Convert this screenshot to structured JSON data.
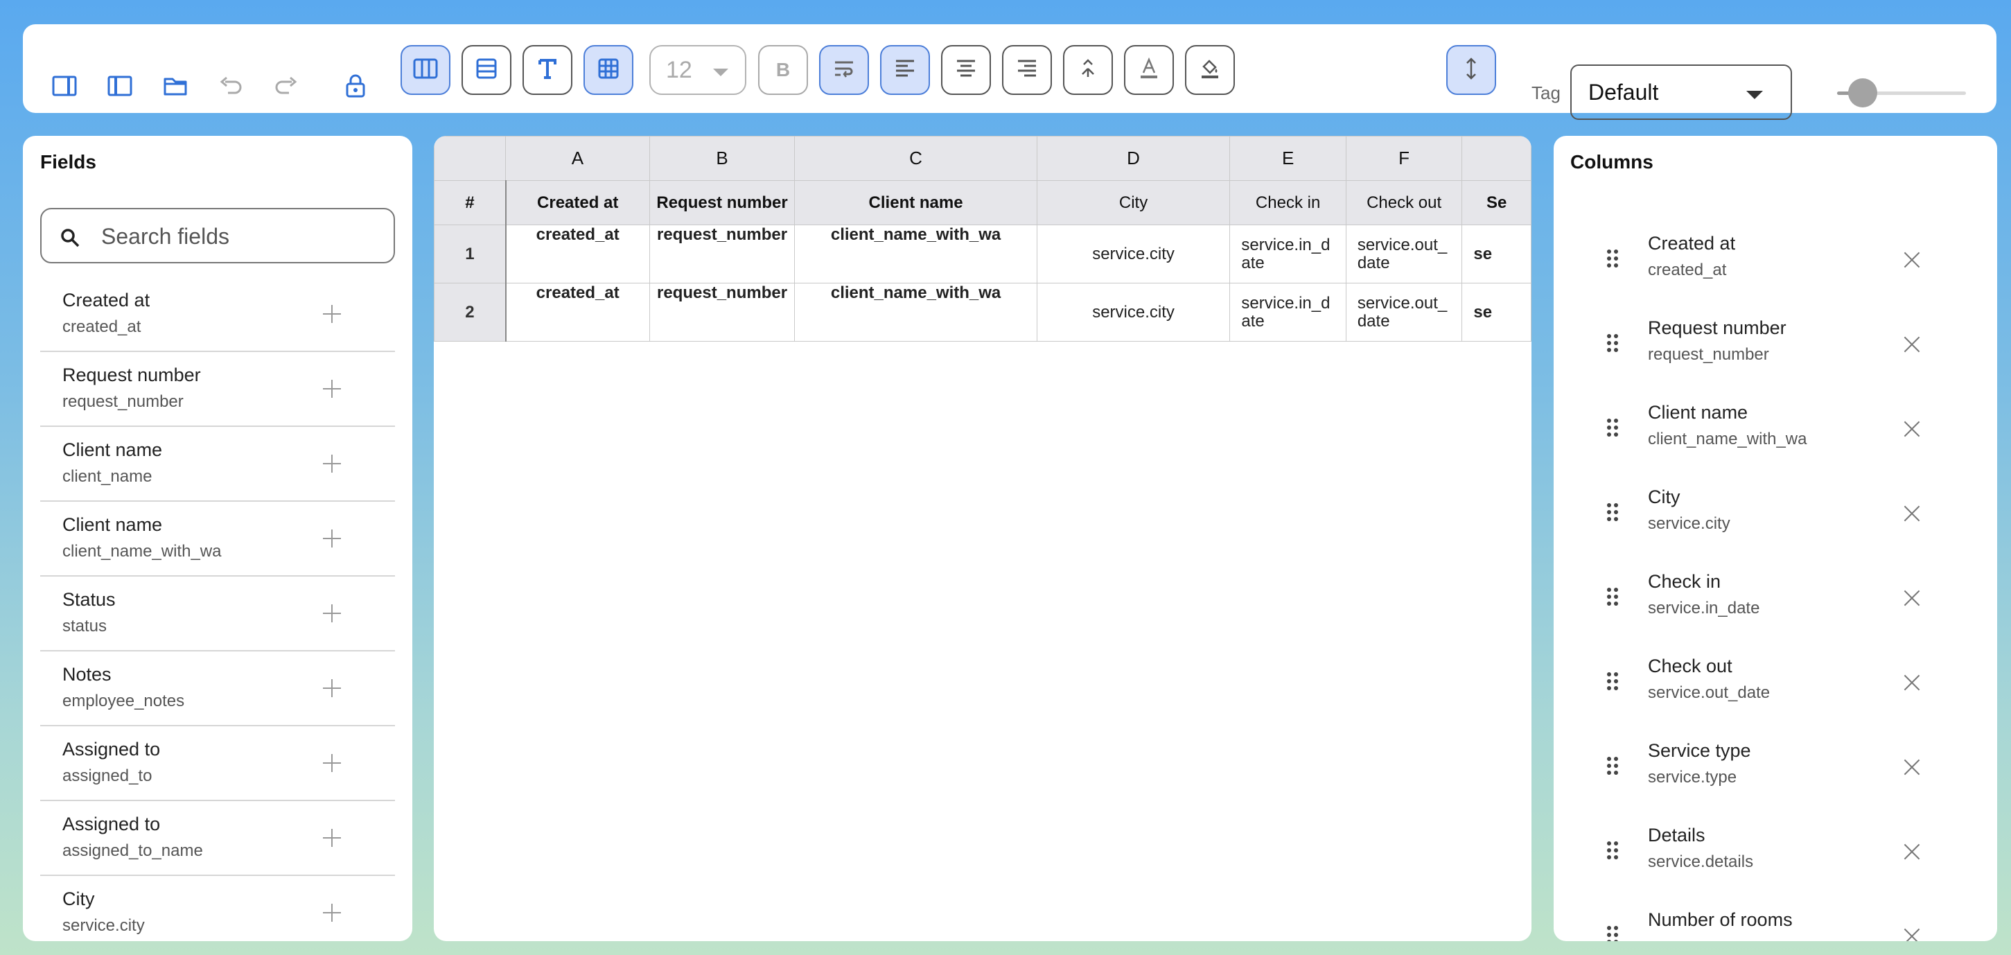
{
  "toolbar": {
    "font_size": "12",
    "bold_label": "B",
    "tag_label": "Tag",
    "tag_value": "Default",
    "zoom_level": 0.2,
    "active_buttons": [
      "columns-mode",
      "grid",
      "wrap-text",
      "align-left",
      "row-height"
    ]
  },
  "fields_panel": {
    "title": "Fields",
    "search_placeholder": "Search fields",
    "items": [
      {
        "label": "Created at",
        "key": "created_at"
      },
      {
        "label": "Request number",
        "key": "request_number"
      },
      {
        "label": "Client name",
        "key": "client_name"
      },
      {
        "label": "Client name",
        "key": "client_name_with_wa"
      },
      {
        "label": "Status",
        "key": "status"
      },
      {
        "label": "Notes",
        "key": "employee_notes"
      },
      {
        "label": "Assigned to",
        "key": "assigned_to"
      },
      {
        "label": "Assigned to",
        "key": "assigned_to_name"
      },
      {
        "label": "City",
        "key": "service.city"
      }
    ]
  },
  "table": {
    "corner": "",
    "row_header": "#",
    "column_letters": [
      "A",
      "B",
      "C",
      "D",
      "E",
      "F",
      ""
    ],
    "headers": [
      "Created at",
      "Request number",
      "Client name",
      "City",
      "Check in",
      "Check out",
      "Se"
    ],
    "rows": [
      {
        "num": "1",
        "cells": [
          "created_at",
          "request_number",
          "client_name_with_wa",
          "service.city",
          "service.in_date",
          "service.out_date",
          "se"
        ]
      },
      {
        "num": "2",
        "cells": [
          "created_at",
          "request_number",
          "client_name_with_wa",
          "service.city",
          "service.in_date",
          "service.out_date",
          "se"
        ]
      }
    ]
  },
  "columns_panel": {
    "title": "Columns",
    "items": [
      {
        "label": "Created at",
        "key": "created_at"
      },
      {
        "label": "Request number",
        "key": "request_number"
      },
      {
        "label": "Client name",
        "key": "client_name_with_wa"
      },
      {
        "label": "City",
        "key": "service.city"
      },
      {
        "label": "Check in",
        "key": "service.in_date"
      },
      {
        "label": "Check out",
        "key": "service.out_date"
      },
      {
        "label": "Service type",
        "key": "service.type"
      },
      {
        "label": "Details",
        "key": "service.details"
      },
      {
        "label": "Number of rooms",
        "key": ""
      }
    ]
  },
  "colors": {
    "accent": "#4d7fd9",
    "active_bg": "#d5e1fb",
    "icon_blue": "#2f6fd6"
  }
}
